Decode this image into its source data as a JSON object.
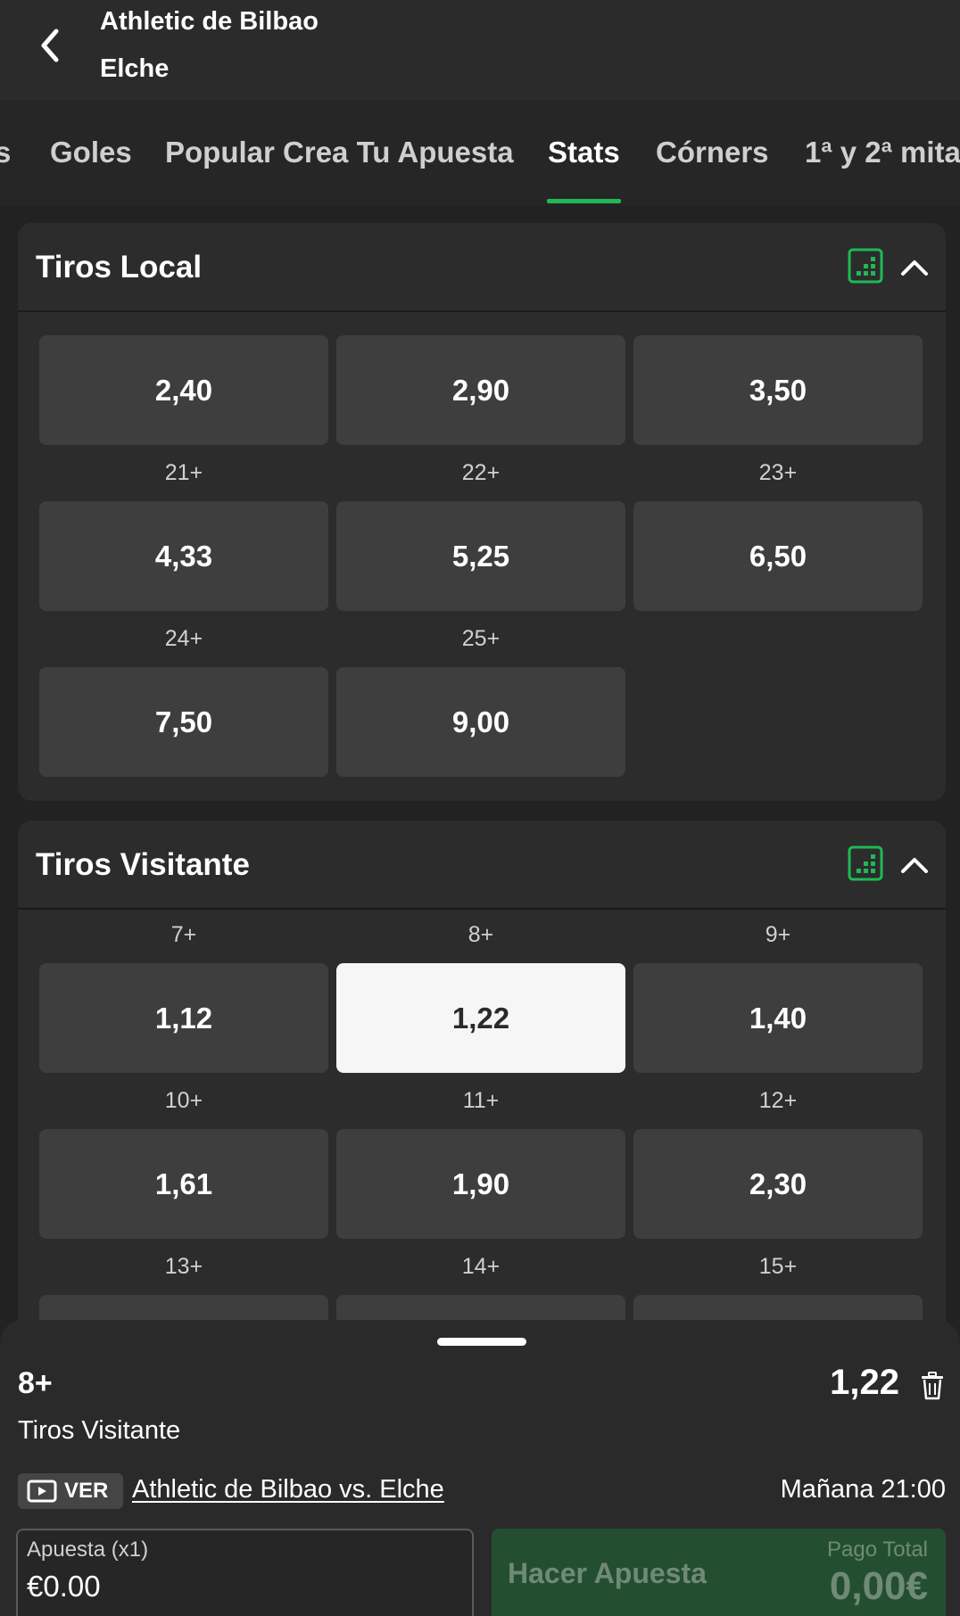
{
  "header": {
    "home_team": "Athletic de Bilbao",
    "away_team": "Elche"
  },
  "tabs": [
    {
      "label": "s"
    },
    {
      "label": "Goles"
    },
    {
      "label": "Popular Crea Tu Apuesta"
    },
    {
      "label": "Stats",
      "active": true
    },
    {
      "label": "Córners"
    },
    {
      "label": "1ª y 2ª mita"
    }
  ],
  "colors": {
    "accent": "#1eb955",
    "background": "#222222",
    "card": "#2c2c2c",
    "odd_button": "#3e3e3e",
    "selected_button": "#f6f6f6"
  },
  "markets": [
    {
      "title": "Tiros Local",
      "rows": [
        {
          "labels": [
            "",
            "",
            ""
          ],
          "odds": [
            "2,40",
            "2,90",
            "3,50"
          ]
        },
        {
          "labels": [
            "21+",
            "22+",
            "23+"
          ],
          "odds": [
            "4,33",
            "5,25",
            "6,50"
          ]
        },
        {
          "labels": [
            "24+",
            "25+"
          ],
          "odds": [
            "7,50",
            "9,00"
          ]
        }
      ]
    },
    {
      "title": "Tiros Visitante",
      "rows": [
        {
          "labels": [
            "7+",
            "8+",
            "9+"
          ],
          "odds": [
            "1,12",
            "1,22",
            "1,40"
          ]
        },
        {
          "labels": [
            "10+",
            "11+",
            "12+"
          ],
          "odds": [
            "1,61",
            "1,90",
            "2,30"
          ]
        },
        {
          "labels": [
            "13+",
            "14+",
            "15+"
          ],
          "odds": [
            "",
            "",
            ""
          ]
        }
      ]
    }
  ],
  "betslip": {
    "selection": "8+",
    "odds": "1,22",
    "market": "Tiros Visitante",
    "ver_label": "VER",
    "match": "Athletic de Bilbao vs. Elche",
    "time": "Mañana 21:00",
    "stake_label": "Apuesta (x1)",
    "stake_value": "€0.00",
    "place_bet_label": "Hacer Apuesta",
    "payout_label": "Pago Total",
    "payout_value": "0,00€"
  }
}
